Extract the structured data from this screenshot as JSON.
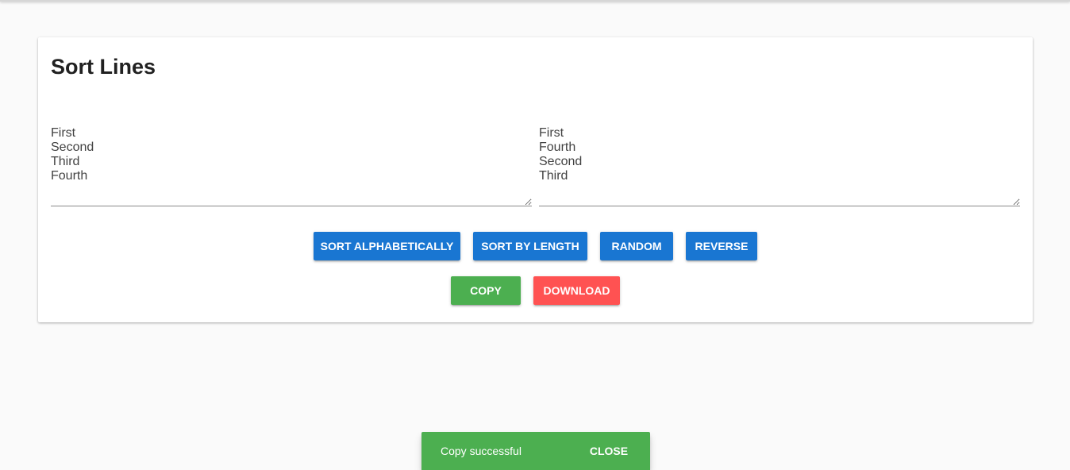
{
  "page": {
    "title": "Sort Lines"
  },
  "input": {
    "value": "First\nSecond\nThird\nFourth"
  },
  "output": {
    "value": "First\nFourth\nSecond\nThird"
  },
  "actions": {
    "sort_alphabetically": "SORT ALPHABETICALLY",
    "sort_by_length": "SORT BY LENGTH",
    "random": "RANDOM",
    "reverse": "REVERSE",
    "copy": "COPY",
    "download": "DOWNLOAD"
  },
  "snackbar": {
    "message": "Copy successful",
    "close_label": "CLOSE"
  },
  "colors": {
    "primary": "#1976d2",
    "success": "#4caf50",
    "danger": "#ff5252",
    "background": "#fafafa"
  }
}
